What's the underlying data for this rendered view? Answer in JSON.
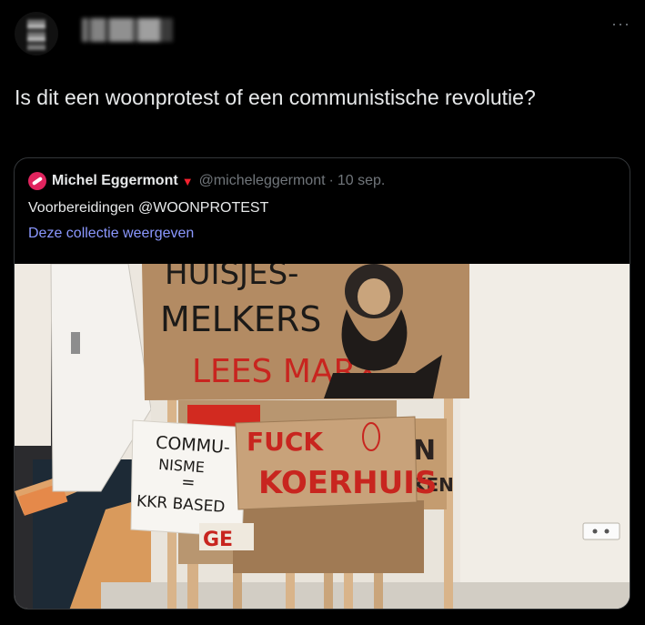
{
  "tweet": {
    "more_label": "···",
    "text": "Is dit een woonprotest of een communistische revolutie?"
  },
  "quoted": {
    "author_name": "Michel Eggermont",
    "verified_mark": "▼",
    "handle": "@micheleggermont",
    "separator": "·",
    "date": "10 sep.",
    "text": "Voorbereidingen @WOONPROTEST",
    "collection_link": "Deze collectie weergeven"
  },
  "signs": {
    "top_line1": "HUISJES-",
    "top_line2": "MELKERS",
    "top_line3": "LEES MARX",
    "left_line1": "COMMU-",
    "left_line2": "NISME",
    "left_line3": "=",
    "left_line4": "KKR BASED",
    "center_line1": "FUCK",
    "center_line2": "KOERHUIS",
    "right_line1": "N",
    "right_line2": "KEN",
    "bottom_frag": "GE"
  },
  "colors": {
    "background": "#000000",
    "text": "#e7e9ea",
    "muted": "#71767b",
    "link": "#8b98ff",
    "accent_red": "#f4212e",
    "cardboard": "#b08a62",
    "sign_red": "#c8251f"
  }
}
